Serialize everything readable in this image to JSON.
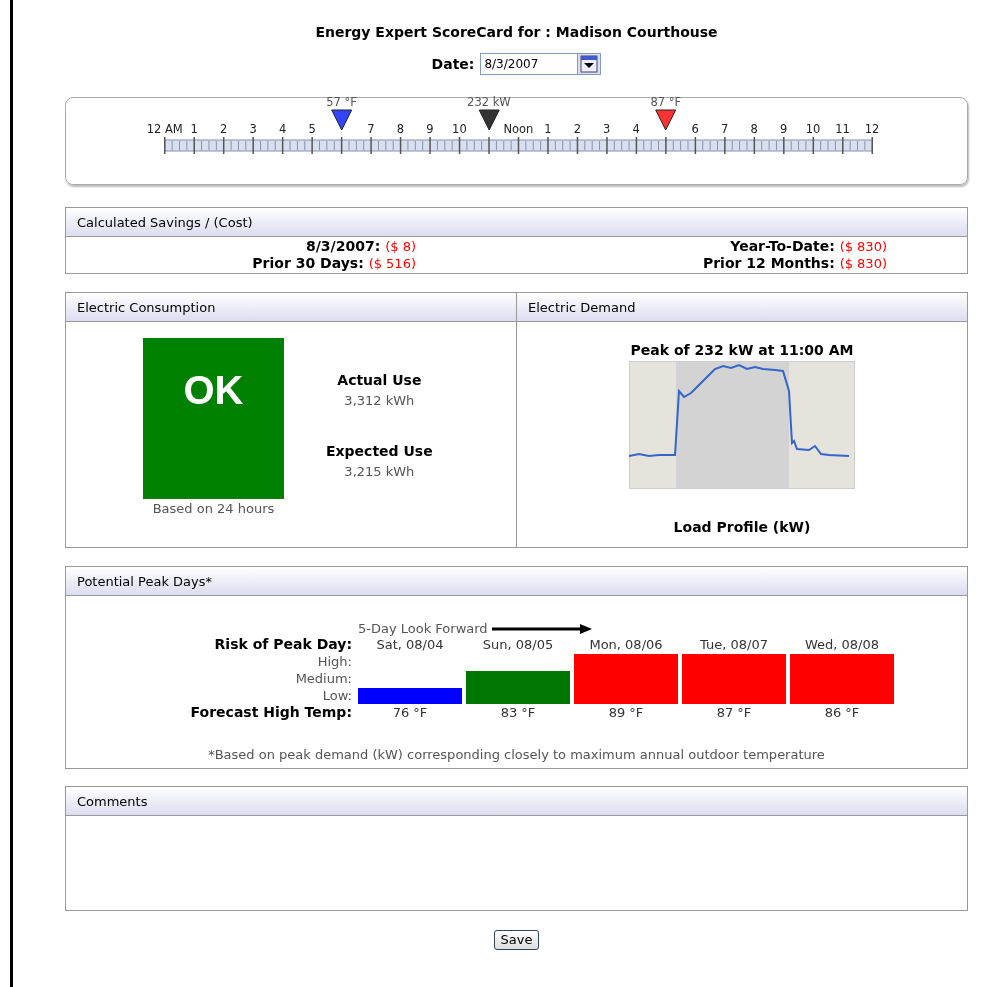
{
  "title": "Energy Expert ScoreCard for : Madison Courthouse",
  "date": {
    "label": "Date:",
    "value": "8/3/2007"
  },
  "timeline": [
    {
      "label": "12 AM"
    },
    {
      "label": "1"
    },
    {
      "label": "2"
    },
    {
      "label": "3"
    },
    {
      "label": "4"
    },
    {
      "label": "5"
    },
    {
      "marker": {
        "reading": "57 °F",
        "color": "#3344ff"
      }
    },
    {
      "label": "7"
    },
    {
      "label": "8"
    },
    {
      "label": "9"
    },
    {
      "label": "10"
    },
    {
      "marker": {
        "reading": "232 kW",
        "color": "#333333"
      }
    },
    {
      "label": "Noon"
    },
    {
      "label": "1"
    },
    {
      "label": "2"
    },
    {
      "label": "3"
    },
    {
      "label": "4"
    },
    {
      "marker": {
        "reading": "87 °F",
        "color": "#ff3333"
      }
    },
    {
      "label": "6"
    },
    {
      "label": "7"
    },
    {
      "label": "8"
    },
    {
      "label": "9"
    },
    {
      "label": "10"
    },
    {
      "label": "11"
    },
    {
      "label": "12"
    }
  ],
  "savings": {
    "title": "Calculated Savings / (Cost)",
    "items": [
      {
        "label": "8/3/2007:",
        "value": "($ 8)"
      },
      {
        "label": "Year-To-Date:",
        "value": "($ 830)"
      },
      {
        "label": "Prior 30 Days:",
        "value": "($ 516)"
      },
      {
        "label": "Prior 12 Months:",
        "value": "($ 830)"
      }
    ]
  },
  "consumption": {
    "title": "Electric Consumption",
    "status": "OK",
    "note": "Based on 24 hours",
    "figures": [
      {
        "label": "Actual Use",
        "value": "3,312 kWh"
      },
      {
        "label": "Expected Use",
        "value": "3,215 kWh"
      }
    ]
  },
  "demand": {
    "title": "Electric Demand",
    "peak": "Peak of 232 kW at 11:00 AM",
    "chart_caption": "Load Profile (kW)"
  },
  "peak_days": {
    "title": "Potential Peak Days*",
    "look_forward": "5-Day Look Forward",
    "risk_label": "Risk of Peak Day:",
    "levels": [
      "High:",
      "Medium:",
      "Low:"
    ],
    "temp_label": "Forecast High Temp:",
    "days": [
      {
        "day": "Sat, 08/04",
        "kind": "low",
        "color": "#0000ff",
        "temp": "76 °F"
      },
      {
        "day": "Sun, 08/05",
        "kind": "medium",
        "color": "#007700",
        "temp": "83 °F"
      },
      {
        "day": "Mon, 08/06",
        "kind": "high",
        "color": "#ff0000",
        "temp": "89 °F"
      },
      {
        "day": "Tue, 08/07",
        "kind": "high",
        "color": "#ff0000",
        "temp": "87 °F"
      },
      {
        "day": "Wed, 08/08",
        "kind": "high",
        "color": "#ff0000",
        "temp": "86 °F"
      }
    ],
    "footnote": "*Based on peak demand (kW) corresponding closely to maximum annual outdoor temperature"
  },
  "comments": {
    "title": "Comments"
  },
  "save": "Save"
}
